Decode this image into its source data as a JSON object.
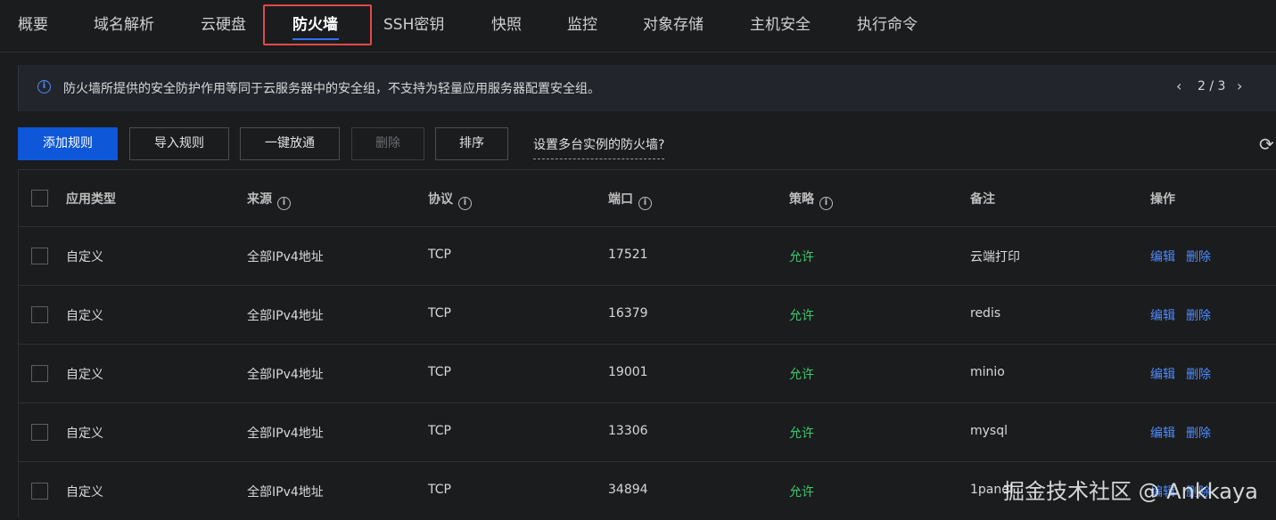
{
  "tabs": [
    {
      "label": "概要"
    },
    {
      "label": "域名解析"
    },
    {
      "label": "云硬盘"
    },
    {
      "label": "防火墙"
    },
    {
      "label": "SSH密钥"
    },
    {
      "label": "快照"
    },
    {
      "label": "监控"
    },
    {
      "label": "对象存储"
    },
    {
      "label": "主机安全"
    },
    {
      "label": "执行命令"
    }
  ],
  "active_tab": "防火墙",
  "notice": {
    "icon": "info-icon",
    "text": "防火墙所提供的安全防护作用等同于云服务器中的安全组，不支持为轻量应用服务器配置安全组。",
    "pager": "2 / 3",
    "prev": "‹",
    "next": "›"
  },
  "toolbar": {
    "add": "添加规则",
    "import": "导入规则",
    "allow_all": "一键放通",
    "delete": "删除",
    "sort": "排序",
    "multi_instance": "设置多台实例的防火墙?",
    "refresh_icon": "refresh-icon"
  },
  "table": {
    "columns": [
      "应用类型",
      "来源",
      "协议",
      "端口",
      "策略",
      "备注",
      "操作"
    ],
    "rows": [
      {
        "type": "自定义",
        "source": "全部IPv4地址",
        "protocol": "TCP",
        "port": "17521",
        "policy": "允许",
        "note": "云端打印",
        "edit": "编辑",
        "delete": "删除"
      },
      {
        "type": "自定义",
        "source": "全部IPv4地址",
        "protocol": "TCP",
        "port": "16379",
        "policy": "允许",
        "note": "redis",
        "edit": "编辑",
        "delete": "删除"
      },
      {
        "type": "自定义",
        "source": "全部IPv4地址",
        "protocol": "TCP",
        "port": "19001",
        "policy": "允许",
        "note": "minio",
        "edit": "编辑",
        "delete": "删除"
      },
      {
        "type": "自定义",
        "source": "全部IPv4地址",
        "protocol": "TCP",
        "port": "13306",
        "policy": "允许",
        "note": "mysql",
        "edit": "编辑",
        "delete": "删除"
      },
      {
        "type": "自定义",
        "source": "全部IPv4地址",
        "protocol": "TCP",
        "port": "34894",
        "policy": "允许",
        "note": "1panel",
        "edit": "编辑",
        "delete": "删除"
      }
    ]
  },
  "watermark": "掘金技术社区 @ Ankkaya",
  "colors": {
    "background": "#1b1c1e",
    "primary": "#0d57d8",
    "link": "#4d8cff",
    "allow": "#3ec96c",
    "highlight": "#e34a46"
  }
}
